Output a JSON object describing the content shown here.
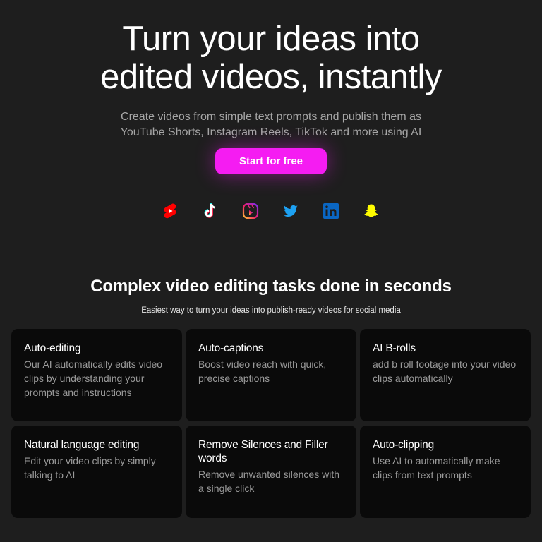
{
  "hero": {
    "title_line1": "Turn your ideas into",
    "title_line2": "edited videos, instantly",
    "subtitle_line1": "Create videos from simple text prompts and publish them as",
    "subtitle_line2": "YouTube Shorts, Instagram Reels, TikTok and more using AI",
    "cta_label": "Start for free"
  },
  "socials": [
    {
      "icon": "youtube-shorts-icon",
      "color": "#ff0000"
    },
    {
      "icon": "tiktok-icon",
      "color": "#ffffff"
    },
    {
      "icon": "instagram-reels-icon",
      "color": "#e1306c"
    },
    {
      "icon": "twitter-icon",
      "color": "#1da1f2"
    },
    {
      "icon": "linkedin-icon",
      "color": "#0a66c2"
    },
    {
      "icon": "snapchat-icon",
      "color": "#fffc00"
    }
  ],
  "features": {
    "title": "Complex video editing tasks done in seconds",
    "subtitle": "Easiest way to turn your ideas into publish-ready videos for social media",
    "cards": [
      {
        "title": "Auto-editing",
        "desc": "Our AI automatically edits video clips by understanding your prompts and instructions"
      },
      {
        "title": "Auto-captions",
        "desc": "Boost video reach with quick, precise captions"
      },
      {
        "title": "AI B-rolls",
        "desc": "add b roll footage into your video clips automatically"
      },
      {
        "title": "Natural language editing",
        "desc": "Edit your video clips by simply talking to AI"
      },
      {
        "title": "Remove Silences and Filler words",
        "desc": "Remove unwanted silences with a single click"
      },
      {
        "title": "Auto-clipping",
        "desc": "Use AI to automatically make clips from text prompts"
      }
    ]
  },
  "colors": {
    "background": "#1e1e1e",
    "card_background": "#0a0a0a",
    "accent": "#f51cf2",
    "muted_text": "#9a9a9a"
  }
}
